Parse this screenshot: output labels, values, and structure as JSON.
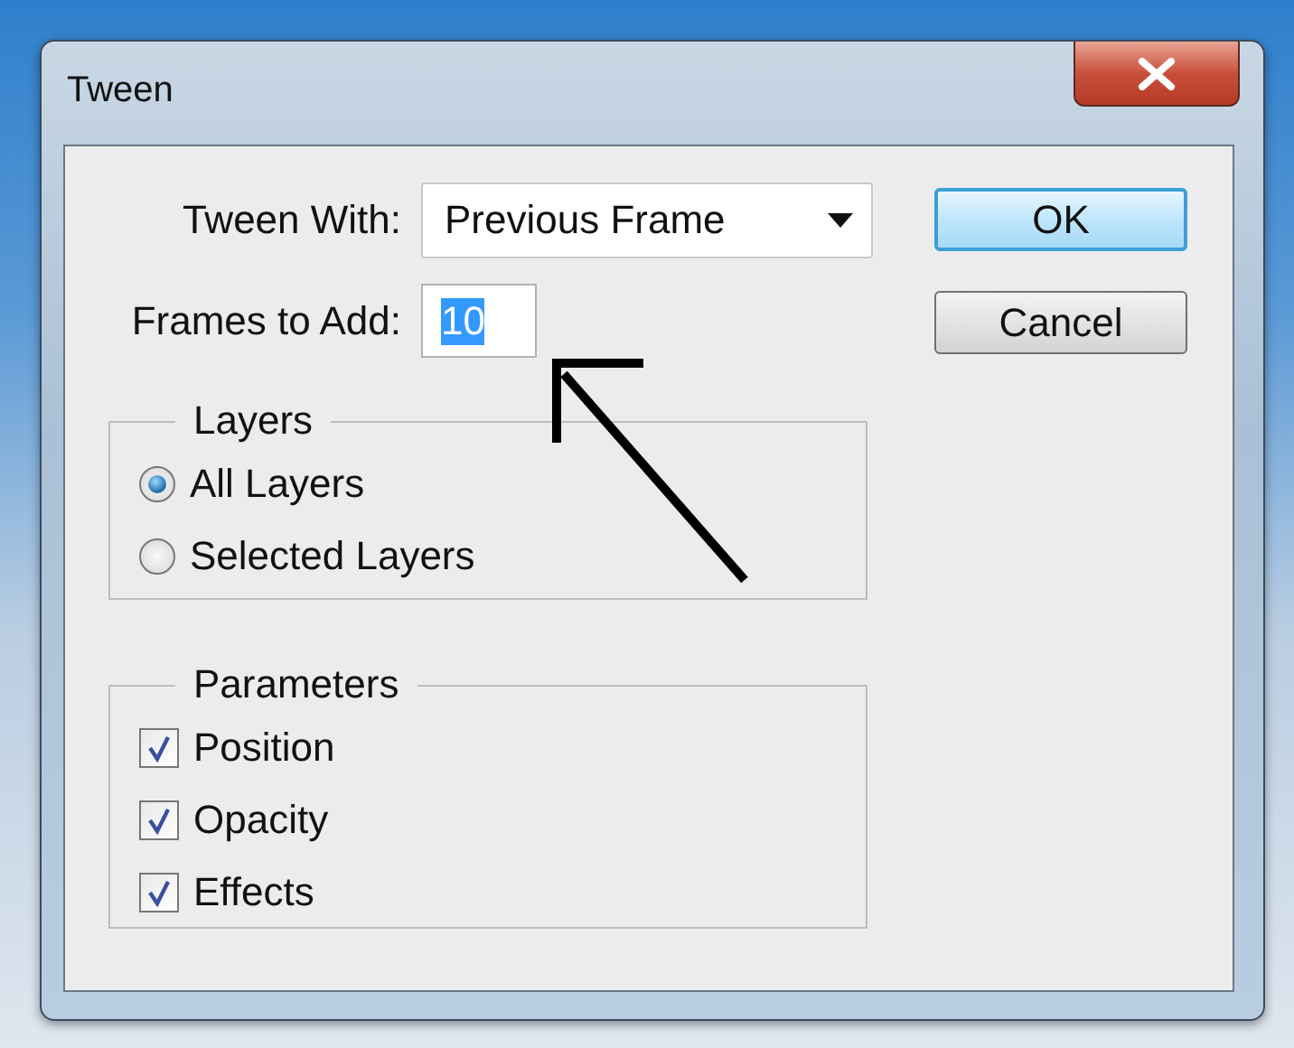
{
  "window": {
    "title": "Tween"
  },
  "tween_with": {
    "label": "Tween With:",
    "value": "Previous Frame"
  },
  "frames_to_add": {
    "label": "Frames to Add:",
    "value": "10",
    "text_selected": true
  },
  "layers": {
    "title": "Layers",
    "options": [
      {
        "label": "All Layers",
        "selected": true
      },
      {
        "label": "Selected Layers",
        "selected": false
      }
    ]
  },
  "parameters": {
    "title": "Parameters",
    "options": [
      {
        "label": "Position",
        "checked": true
      },
      {
        "label": "Opacity",
        "checked": true
      },
      {
        "label": "Effects",
        "checked": true
      }
    ]
  },
  "buttons": [
    {
      "label": "OK",
      "default": true
    },
    {
      "label": "Cancel",
      "default": false
    }
  ]
}
